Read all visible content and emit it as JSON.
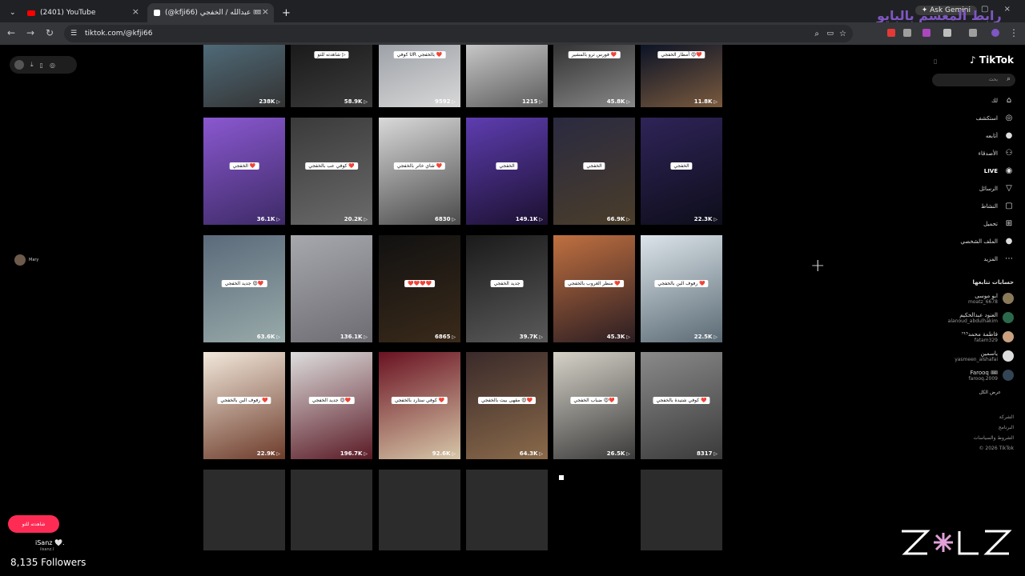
{
  "tabs": [
    {
      "title": "(2401) YouTube"
    },
    {
      "title": "(@kfji66) عبدالله / الخفجي 🎟 | ..."
    }
  ],
  "toolbar": {
    "url": "tiktok.com/@kfji66",
    "ask_gemini": "Ask Gemini",
    "banner": "رابط المعسم بالبايو"
  },
  "grid": [
    [
      {
        "caption": "",
        "views": "238K"
      },
      {
        "caption": "شاهدته للتو ▷",
        "views": "58.9K"
      },
      {
        "caption": "كوفي UR بالخفجي ❤️",
        "views": "9592"
      },
      {
        "caption": "",
        "views": "1215"
      },
      {
        "caption": "فورس ترو بالمشير ❤️",
        "views": "45.8K"
      },
      {
        "caption": "أمطار الخفجي 😍❤️",
        "views": "11.8K"
      }
    ],
    [
      {
        "caption": "الخفجي ❤️",
        "views": "36.1K"
      },
      {
        "caption": "كوفي عب بالخفجي ❤️",
        "views": "20.2K"
      },
      {
        "caption": "شاي خاتر بالخفجي ❤️",
        "views": "6830"
      },
      {
        "caption": "الخفجي",
        "views": "149.1K"
      },
      {
        "caption": "الخفجي",
        "views": "66.9K"
      },
      {
        "caption": "الخفجي",
        "views": "22.3K"
      }
    ],
    [
      {
        "caption": "جديد الخفجي 😍❤️",
        "views": "63.6K"
      },
      {
        "caption": "",
        "views": "136.1K"
      },
      {
        "caption": "❤️❤️❤️❤️",
        "views": "6865"
      },
      {
        "caption": "جديد الخفجي",
        "views": "39.7K"
      },
      {
        "caption": "منظر الغروب بالخفجي ❤️",
        "views": "45.3K"
      },
      {
        "caption": "رفوف البن بالخفجي ❤️",
        "views": "22.5K"
      }
    ],
    [
      {
        "caption": "رفوف البن بالخفجي ❤️",
        "views": "22.9K"
      },
      {
        "caption": "جديد الخفجي 😍❤️",
        "views": "196.7K"
      },
      {
        "caption": "كوفي ستارد بالخفجي ❤️",
        "views": "92.6K"
      },
      {
        "caption": "مقهى بيت بالخفجي 😍❤️",
        "views": "64.3K"
      },
      {
        "caption": "ضباب الخفجي 😍❤️",
        "views": "26.5K"
      },
      {
        "caption": "كوفي شتيدة بالخفجي ❤️",
        "views": "8317"
      }
    ]
  ],
  "sidebar": {
    "brand": "TikTok",
    "search_placeholder": "بحث",
    "nav": [
      "لك",
      "استكشف",
      "أتابعه",
      "الأصدقاء",
      "LIVE",
      "الرسائل",
      "النشاط",
      "تحميل",
      "الملف الشخصي",
      "المزيد"
    ],
    "following_title": "حسابات تتابعها",
    "accounts": [
      {
        "name": "ابو موسى",
        "handle": "moatz_6678"
      },
      {
        "name": "العنود عبدالحكيم",
        "handle": "alanoud_abdulhakim"
      },
      {
        "name": "فاطمة محمد⁷¹⁵",
        "handle": "fatam329"
      },
      {
        "name": "ياسمين",
        "handle": "yasmeen_alshafai"
      },
      {
        "name": "Farooq 🎟",
        "handle": "farooq.2009"
      }
    ],
    "see_all": "عرض الكل",
    "footer": [
      "الشركة",
      "البرنامج",
      "الشروط والسياسات",
      "© 2026 TikTok"
    ]
  },
  "left": {
    "mini_user": "Mary",
    "watched_button": "شاهدته للتو",
    "user": "iSanz 🤍.",
    "handle": "iisanz.l",
    "followers": "8,135 Followers"
  },
  "colors": {
    "tiktok_pink": "#fe2c55",
    "accent_purple": "#7e57c2"
  }
}
